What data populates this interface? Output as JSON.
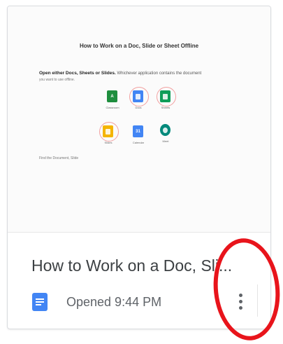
{
  "thumbnail": {
    "title": "How to Work on a Doc, Slide or Sheet Offline",
    "line1_bold": "Open either Docs, Sheets or Slides.",
    "line1_rest": " Whichever application contains the document",
    "line2": "you want to use offline.",
    "apps": [
      {
        "label": "Classroom",
        "color": "#1e8e3e",
        "icon": "classroom-icon"
      },
      {
        "label": "Docs",
        "color": "#4285f4",
        "icon": "docs-icon"
      },
      {
        "label": "Sheets",
        "color": "#0f9d58",
        "icon": "sheets-icon"
      },
      {
        "label": "Slides",
        "color": "#f4b400",
        "icon": "slides-icon"
      },
      {
        "label": "Calendar",
        "color": "#4285f4",
        "icon": "calendar-icon"
      },
      {
        "label": "Meet",
        "color": "#00897b",
        "icon": "meet-icon"
      }
    ],
    "calendar_day": "31",
    "find_text": "Find the Document, Slide"
  },
  "file": {
    "name": "How to Work on a Doc, Sli...",
    "opened": "Opened 9:44 PM",
    "type_icon": "docs-icon",
    "type_color": "#4285f4"
  },
  "menu": {
    "icon": "more-vert-icon"
  },
  "annotation": {
    "color": "#e8141b"
  }
}
